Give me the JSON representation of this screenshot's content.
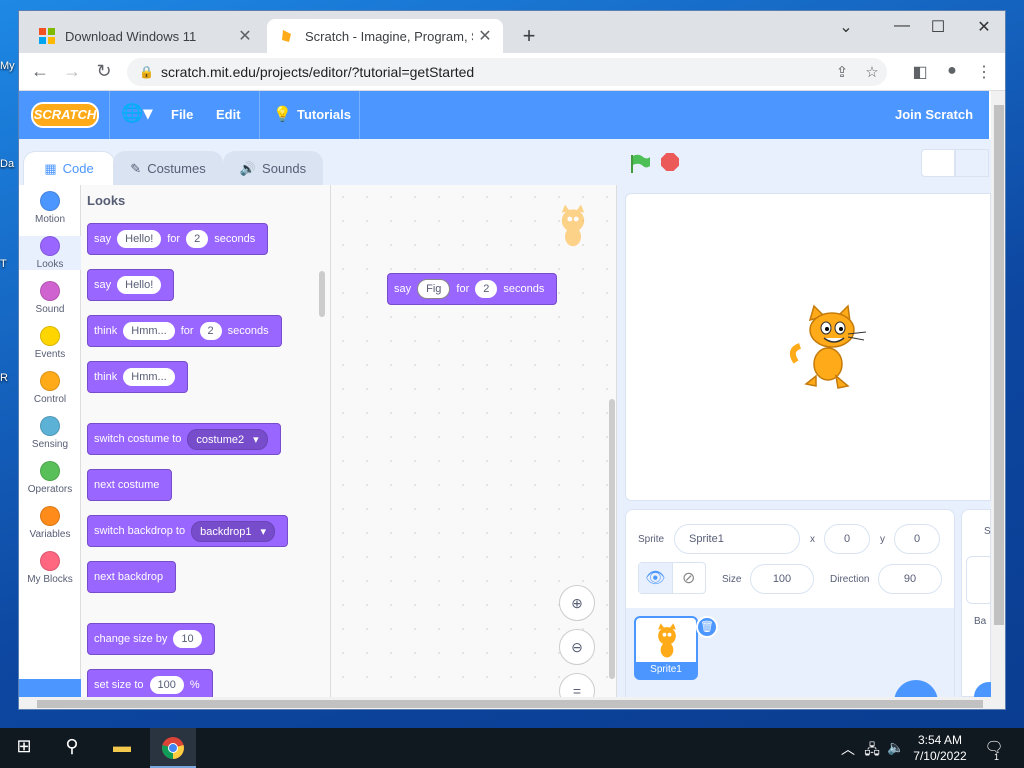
{
  "desktop": {
    "icon_labels": [
      "My",
      "Da",
      "T",
      "R"
    ]
  },
  "browser": {
    "tabs": [
      {
        "title": "Download Windows 11",
        "favicon": "windows-logo-icon"
      },
      {
        "title": "Scratch - Imagine, Program, Shar",
        "favicon": "scratch-icon"
      }
    ],
    "url": "scratch.mit.edu/projects/editor/?tutorial=getStarted"
  },
  "menubar": {
    "logo": "SCRATCH",
    "file": "File",
    "edit": "Edit",
    "tutorials": "Tutorials",
    "join": "Join Scratch"
  },
  "editor_tabs": {
    "code": "Code",
    "costumes": "Costumes",
    "sounds": "Sounds"
  },
  "categories": [
    {
      "label": "Motion",
      "color": "#4c97ff"
    },
    {
      "label": "Looks",
      "color": "#9966ff"
    },
    {
      "label": "Sound",
      "color": "#cf63cf"
    },
    {
      "label": "Events",
      "color": "#ffd500"
    },
    {
      "label": "Control",
      "color": "#ffab19"
    },
    {
      "label": "Sensing",
      "color": "#5cb1d6"
    },
    {
      "label": "Operators",
      "color": "#59c059"
    },
    {
      "label": "Variables",
      "color": "#ff8c1a"
    },
    {
      "label": "My Blocks",
      "color": "#ff6680"
    }
  ],
  "palette": {
    "heading": "Looks",
    "blocks": [
      {
        "say": "say",
        "arg": "Hello!",
        "for": "for",
        "secs": "2",
        "unit": "seconds"
      },
      {
        "say": "say",
        "arg": "Hello!"
      },
      {
        "say": "think",
        "arg": "Hmm...",
        "for": "for",
        "secs": "2",
        "unit": "seconds"
      },
      {
        "say": "think",
        "arg": "Hmm..."
      },
      {
        "say": "switch costume to",
        "drop": "costume2"
      },
      {
        "say": "next costume"
      },
      {
        "say": "switch backdrop to",
        "drop": "backdrop1"
      },
      {
        "say": "next backdrop"
      },
      {
        "say": "change size by",
        "arg": "10"
      },
      {
        "say": "set size to",
        "arg": "100",
        "unit": "%"
      }
    ]
  },
  "workspace_block": {
    "say": "say",
    "arg": "Fig",
    "for": "for",
    "secs": "2",
    "unit": "seconds"
  },
  "sprite_info": {
    "sprite_label": "Sprite",
    "sprite_name": "Sprite1",
    "x_label": "x",
    "x": "0",
    "y_label": "y",
    "y": "0",
    "size_label": "Size",
    "size": "100",
    "direction_label": "Direction",
    "direction": "90",
    "thumb_name": "Sprite1"
  },
  "backdrop_panel": {
    "label_s": "S",
    "label_ba": "Ba"
  },
  "taskbar": {
    "time": "3:54 AM",
    "date": "7/10/2022",
    "notification_count": "1"
  }
}
